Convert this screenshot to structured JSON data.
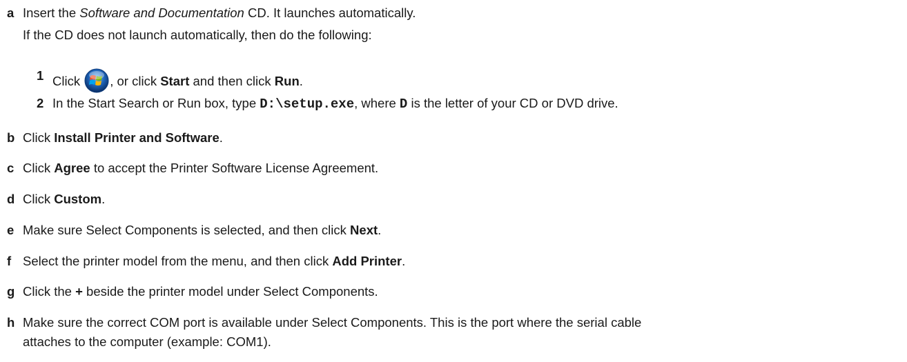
{
  "steps": {
    "a": {
      "letter": "a",
      "t1": "Insert the ",
      "t2": "Software and Documentation",
      "t3": " CD. It launches automatically.",
      "line2": "If the CD does not launch automatically, then do the following:",
      "s1": {
        "num": "1",
        "t1": "Click ",
        "t2": ", or click ",
        "start": "Start",
        "t3": " and then click ",
        "run": "Run",
        "t4": "."
      },
      "s2": {
        "num": "2",
        "t1": "In the Start Search or Run box, type ",
        "code": "D:\\setup.exe",
        "t2": ", where ",
        "d": "D",
        "t3": " is the letter of your CD or DVD drive."
      }
    },
    "b": {
      "letter": "b",
      "t1": "Click ",
      "bold": "Install Printer and Software",
      "t2": "."
    },
    "c": {
      "letter": "c",
      "t1": "Click ",
      "bold": "Agree",
      "t2": " to accept the Printer Software License Agreement."
    },
    "d": {
      "letter": "d",
      "t1": "Click ",
      "bold": "Custom",
      "t2": "."
    },
    "e": {
      "letter": "e",
      "t1": "Make sure Select Components is selected, and then click ",
      "bold": "Next",
      "t2": "."
    },
    "f": {
      "letter": "f",
      "t1": "Select the printer model from the menu, and then click ",
      "bold": "Add Printer",
      "t2": "."
    },
    "g": {
      "letter": "g",
      "t1": "Click the ",
      "bold": "+",
      "t2": " beside the printer model under Select Components."
    },
    "h": {
      "letter": "h",
      "line1": "Make sure the correct COM port is available under Select Components. This is the port where the serial cable",
      "line2": "attaches to the computer (example: COM1)."
    }
  },
  "icons": {
    "start": "windows-start-orb-icon"
  },
  "colors": {
    "orb_blue": "#1d63b8"
  }
}
